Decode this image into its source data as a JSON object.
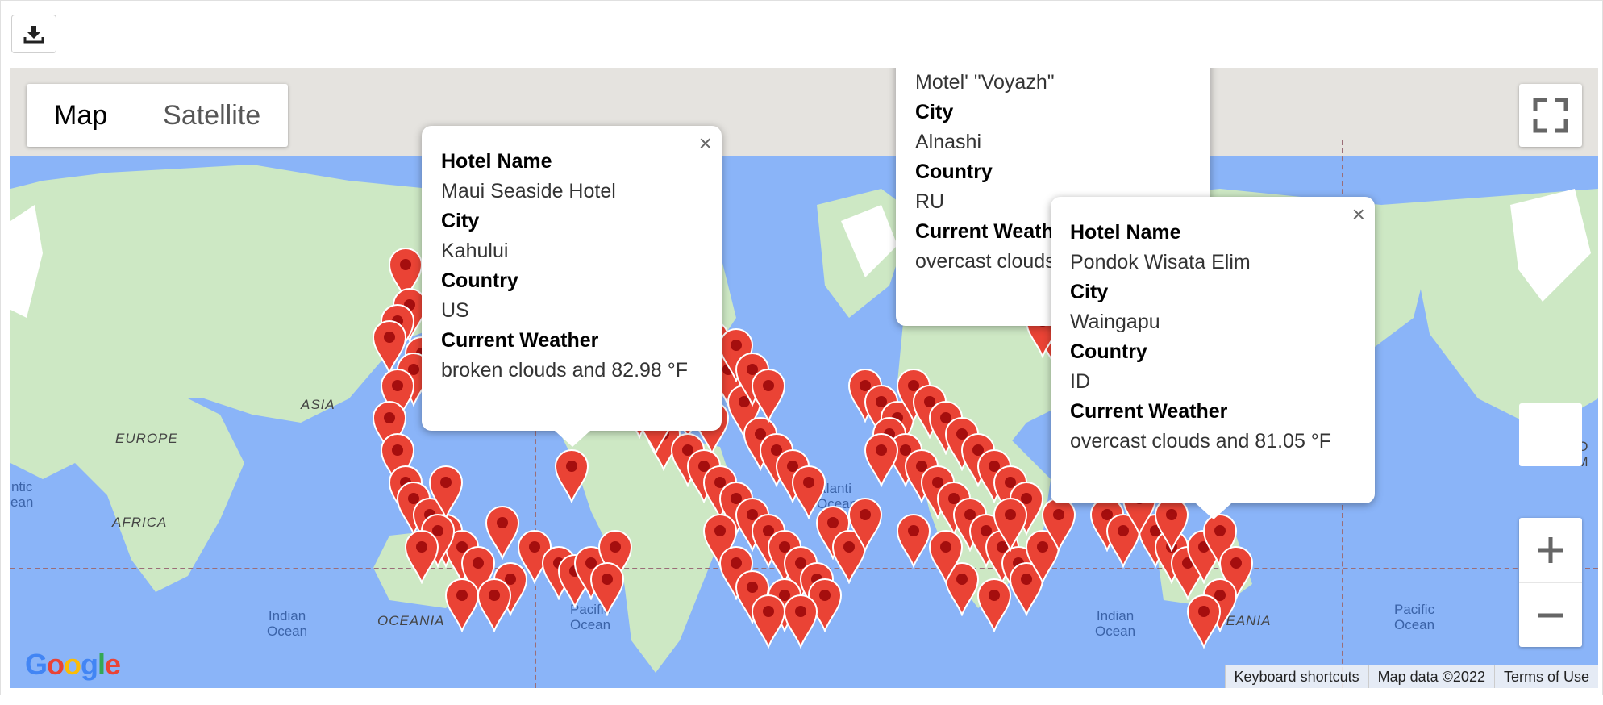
{
  "toolbar": {
    "download_icon": "download-icon"
  },
  "map_type": {
    "map_label": "Map",
    "satellite_label": "Satellite"
  },
  "region_labels": {
    "asia": "ASIA",
    "europe": "EUROPE",
    "africa": "AFRICA",
    "oceania_left": "OCEANIA",
    "oceania_right": "OCEANIA",
    "north_america_partial": "NO\nAM"
  },
  "ocean_labels": {
    "atlantic_left": "ntic\nean",
    "indian_left": "Indian\nOcean",
    "pacific_left": "Pacific\nOcean",
    "atlantic_mid": "tlanti\nOcean",
    "indian_right": "Indian\nOcean",
    "pacific_right": "Pacific\nOcean"
  },
  "popups": [
    {
      "hotel_name_label": "Hotel Name",
      "hotel_name": "Maui Seaside Hotel",
      "city_label": "City",
      "city": "Kahului",
      "country_label": "Country",
      "country": "US",
      "weather_label": "Current Weather",
      "weather": "broken clouds and 82.98 °F",
      "close": "×"
    },
    {
      "hotel_name": "Motel' \"Voyazh\"",
      "city_label": "City",
      "city": "Alnashi",
      "country_label": "Country",
      "country": "RU",
      "weather_label": "Current Weath",
      "weather": "overcast clouds"
    },
    {
      "hotel_name_label": "Hotel Name",
      "hotel_name": "Pondok Wisata Elim",
      "city_label": "City",
      "city": "Waingapu",
      "country_label": "Country",
      "country": "ID",
      "weather_label": "Current Weather",
      "weather": "overcast clouds and 81.05 °F",
      "close": "×"
    }
  ],
  "footer": {
    "keyboard": "Keyboard shortcuts",
    "map_data": "Map data ©2022",
    "terms": "Terms of Use"
  },
  "google_logo": {
    "G": "G",
    "o1": "o",
    "o2": "o",
    "g": "g",
    "l": "l",
    "e": "e"
  },
  "colors": {
    "ocean": "#8ab4f8",
    "land": "#cde8c4",
    "pin": "#ea4335",
    "pin_dot": "#a50e0e"
  }
}
